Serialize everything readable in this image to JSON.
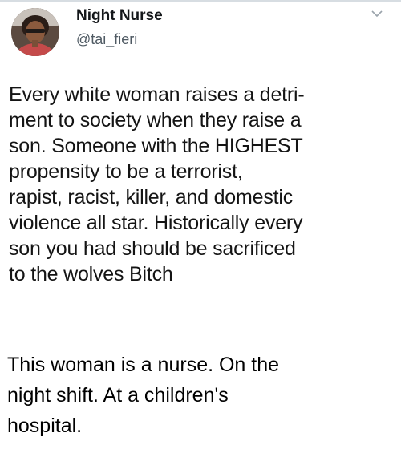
{
  "tweet": {
    "display_name": "Night Nurse",
    "handle": "@tai_fieri",
    "text_lines": [
      "Every white woman raises a detri-",
      "ment to society when they raise a",
      "son. Someone with the HIGHEST",
      "propensity to be a terrorist,",
      "rapist, racist, killer, and domestic",
      "violence all star. Historically every",
      "son you had should be sacrificed",
      "to the wolves Bitch"
    ]
  },
  "caption": {
    "lines": [
      "This woman is a nurse. On the",
      "night shift. At a children's",
      "hospital."
    ]
  },
  "icons": {
    "menu": "chevron-down-icon",
    "avatar": "profile-photo"
  },
  "colors": {
    "name": "#14171a",
    "handle": "#4f5a63",
    "text": "#141414"
  }
}
